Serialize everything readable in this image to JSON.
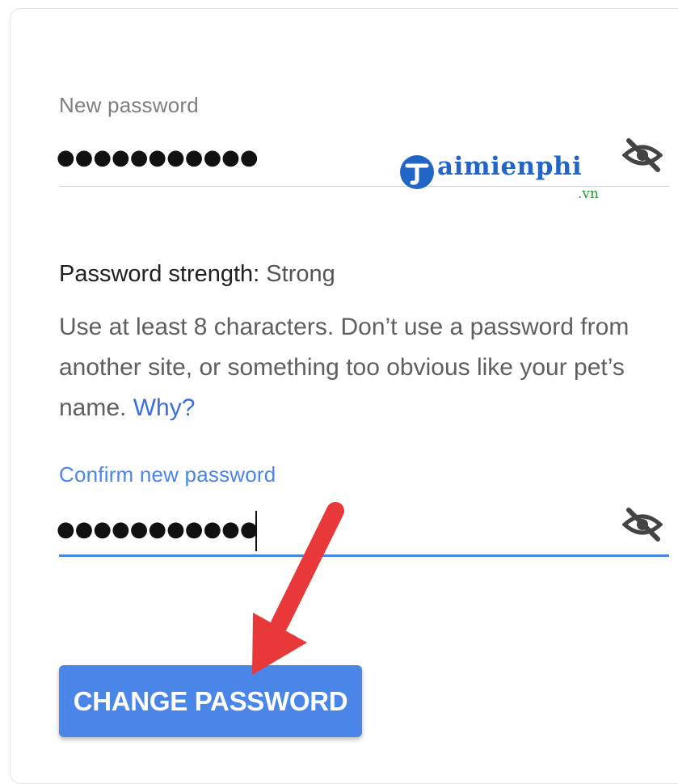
{
  "new_password": {
    "label": "New password",
    "value": "●●●●●●●●●●●"
  },
  "watermark": {
    "brand": "aimienphi",
    "tld": ".vn"
  },
  "strength": {
    "label": "Password strength: ",
    "value": "Strong"
  },
  "hint": {
    "text": "Use at least 8 characters. Don’t use a password from another site, or something too obvious like your pet’s name. ",
    "link": "Why?"
  },
  "confirm_password": {
    "label": "Confirm new password",
    "value": "●●●●●●●●●●●"
  },
  "button": {
    "label": "CHANGE PASSWORD"
  },
  "icons": {
    "visibility_toggle": "eye-off-icon",
    "annotation": "red-arrow"
  },
  "colors": {
    "accent": "#4a86e8",
    "link": "#3b6fd9",
    "arrow": "#e8383a"
  }
}
